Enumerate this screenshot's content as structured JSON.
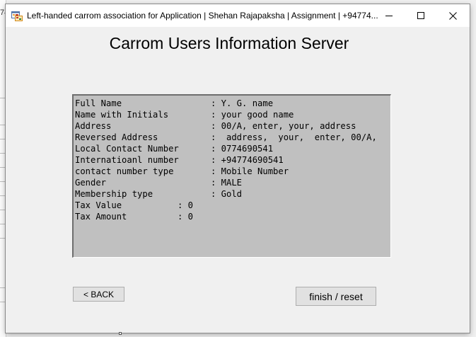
{
  "background": {
    "partial_char": "74"
  },
  "window": {
    "title": "Left-handed carrom association for Application | Shehan Rajapaksha | Assignment | +94774...",
    "icon": "app-form-icon",
    "controls": {
      "minimize": "minimize-icon",
      "maximize": "maximize-icon",
      "close": "close-icon"
    }
  },
  "main": {
    "heading": "Carrom Users Information Server",
    "info_rows": [
      {
        "label": "Full Name",
        "value": ": Y. G. name"
      },
      {
        "label": "Name with Initials",
        "value": ": your good name"
      },
      {
        "label": "Address",
        "value": ": 00/A, enter, your, address"
      },
      {
        "label": "Reversed Address",
        "value": ":  address,  your,  enter, 00/A,"
      },
      {
        "label": "Local Contact Number",
        "value": ": 0774690541"
      },
      {
        "label": "Internatioanl number",
        "value": ": +94774690541"
      },
      {
        "label": "contact number type",
        "value": ": Mobile Number"
      },
      {
        "label": "Gender",
        "value": ": MALE"
      },
      {
        "label": "Membership type",
        "value": ": Gold"
      },
      {
        "label": "Tax Value",
        "value": ": 0"
      },
      {
        "label": "Tax Amount",
        "value": ": 0"
      }
    ],
    "back_button": "< BACK",
    "finish_button": "finish / reset"
  },
  "colors": {
    "info_box_bg": "#c0c0c0",
    "window_bg": "#f0f0f0",
    "button_bg": "#e1e1e1"
  }
}
